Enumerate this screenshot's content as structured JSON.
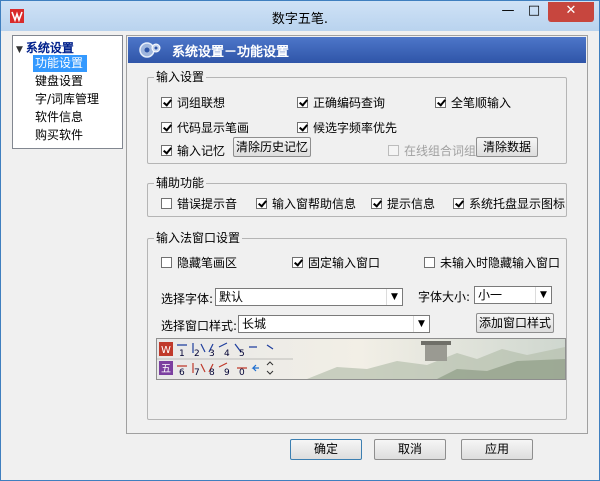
{
  "window": {
    "title": "数字五笔.",
    "minimize": "—",
    "maximize": "□",
    "close": "✕"
  },
  "tree": {
    "root": "系统设置",
    "items": [
      "功能设置",
      "键盘设置",
      "字/词库管理",
      "软件信息",
      "购买软件"
    ],
    "selected_index": 0
  },
  "panel": {
    "title": "系统设置－功能设置"
  },
  "input_settings": {
    "label": "输入设置",
    "word_assoc": {
      "label": "词组联想",
      "checked": true
    },
    "code_query": {
      "label": "正确编码查询",
      "checked": true
    },
    "stroke_order": {
      "label": "全笔顺输入",
      "checked": true
    },
    "show_strokes": {
      "label": "代码显示笔画",
      "checked": true
    },
    "freq_priority": {
      "label": "候选字频率优先",
      "checked": true
    },
    "input_memory": {
      "label": "输入记忆",
      "checked": true
    },
    "clear_history_button": "清除历史记忆",
    "online_combo": {
      "label": "在线组合词组",
      "checked": false,
      "disabled": true
    },
    "clear_data_button": "清除数据"
  },
  "aux": {
    "label": "辅助功能",
    "error_sound": {
      "label": "错误提示音",
      "checked": false
    },
    "help_info": {
      "label": "输入窗帮助信息",
      "checked": true
    },
    "hint_info": {
      "label": "提示信息",
      "checked": true
    },
    "tray_icon": {
      "label": "系统托盘显示图标",
      "checked": true
    }
  },
  "ime_window": {
    "label": "输入法窗口设置",
    "hide_strokes": {
      "label": "隐藏笔画区",
      "checked": false
    },
    "fixed_window": {
      "label": "固定输入窗口",
      "checked": true
    },
    "hide_when_idle": {
      "label": "未输入时隐藏输入窗口",
      "checked": false
    },
    "font_label": "选择字体:",
    "font_value": "默认",
    "font_size_label": "字体大小:",
    "font_size_value": "小一",
    "style_label": "选择窗口样式:",
    "style_value": "长城",
    "add_style_button": "添加窗口样式",
    "preview_numbers": [
      "1",
      "2",
      "3",
      "4",
      "5",
      "6",
      "7",
      "8",
      "9",
      "0"
    ]
  },
  "footer": {
    "ok": "确定",
    "cancel": "取消",
    "apply": "应用"
  }
}
